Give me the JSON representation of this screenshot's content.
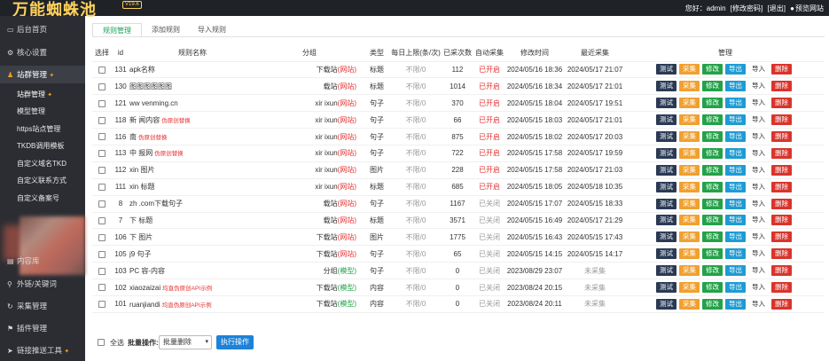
{
  "header": {
    "logo": "万能蜘蛛池",
    "version": "V19.6",
    "greeting": "您好：admin",
    "change_password": "[修改密码]",
    "logout": "[退出]",
    "preview_site": "预览网站"
  },
  "sidebar": {
    "items": [
      {
        "icon": "monitor-icon",
        "label": "后台首页"
      },
      {
        "icon": "gear-icon",
        "label": "核心设置"
      },
      {
        "icon": "user-icon",
        "label": "站群管理"
      }
    ],
    "subitems": [
      "站群管理",
      "模型管理",
      "https站点管理",
      "TKDB调用模板",
      "自定义域名TKD",
      "自定义联系方式",
      "自定义备案号"
    ],
    "bottom_items": [
      {
        "icon": "database-icon",
        "label": "内容库"
      },
      {
        "icon": "link-icon",
        "label": "外链/关键词"
      },
      {
        "icon": "collect-icon",
        "label": "采集管理"
      },
      {
        "icon": "plugin-icon",
        "label": "插件管理"
      },
      {
        "icon": "send-icon",
        "label": "链接推送工具"
      }
    ]
  },
  "tabs": [
    "规则管理",
    "添加规则",
    "导入规则"
  ],
  "table": {
    "headers": [
      "选择",
      "id",
      "规则名称",
      "分组",
      "类型",
      "每日上限(条/次)",
      "已采次数",
      "自动采集",
      "修改时间",
      "最近采集",
      "管理"
    ],
    "buttons": {
      "test": "测试",
      "collect": "采集",
      "edit": "修改",
      "export": "导出",
      "import": "导入",
      "delete": "删除"
    },
    "rows": [
      {
        "id": "131",
        "name": "apk名称",
        "tag": "",
        "group": "下载站",
        "group_suffix": "(网站)",
        "type": "标题",
        "limit": "不限/0",
        "count": "112",
        "auto": "已开启",
        "mtime": "2024/05/16 18:36",
        "last": "2024/05/17 21:07"
      },
      {
        "id": "130",
        "name": "图图图图图图",
        "tag": "",
        "group": "载站",
        "group_suffix": "(网站)",
        "type": "标题",
        "limit": "不限/0",
        "count": "1014",
        "auto": "已开启",
        "mtime": "2024/05/16 18:34",
        "last": "2024/05/17 21:01"
      },
      {
        "id": "121",
        "name": "ww venming.cn",
        "tag": "",
        "group": "xir ixun",
        "group_suffix": "(网站)",
        "type": "句子",
        "limit": "不限/0",
        "count": "370",
        "auto": "已开启",
        "mtime": "2024/05/15 18:04",
        "last": "2024/05/17 19:51"
      },
      {
        "id": "118",
        "name": "新 闻内容",
        "tag": "伪原创替换",
        "group": "xir ixun",
        "group_suffix": "(网站)",
        "type": "句子",
        "limit": "不限/0",
        "count": "66",
        "auto": "已开启",
        "mtime": "2024/05/15 18:03",
        "last": "2024/05/17 21:01"
      },
      {
        "id": "116",
        "name": "南",
        "tag": "伪原创替换",
        "group": "xir ixun",
        "group_suffix": "(网站)",
        "type": "句子",
        "limit": "不限/0",
        "count": "875",
        "auto": "已开启",
        "mtime": "2024/05/15 18:02",
        "last": "2024/05/17 20:03"
      },
      {
        "id": "113",
        "name": "中 报网",
        "tag": "伪原创替换",
        "group": "xir ixun",
        "group_suffix": "(网站)",
        "type": "句子",
        "limit": "不限/0",
        "count": "722",
        "auto": "已开启",
        "mtime": "2024/05/15 17:58",
        "last": "2024/05/17 19:59"
      },
      {
        "id": "112",
        "name": "xin 图片",
        "tag": "",
        "group": "xir ixun",
        "group_suffix": "(网站)",
        "type": "图片",
        "limit": "不限/0",
        "count": "228",
        "auto": "已开启",
        "mtime": "2024/05/15 17:58",
        "last": "2024/05/17 21:03"
      },
      {
        "id": "111",
        "name": "xin 标题",
        "tag": "",
        "group": "xir ixun",
        "group_suffix": "(网站)",
        "type": "标题",
        "limit": "不限/0",
        "count": "685",
        "auto": "已开启",
        "mtime": "2024/05/15 18:05",
        "last": "2024/05/18 10:35"
      },
      {
        "id": "8",
        "name": "zh .com下载句子",
        "tag": "",
        "group": "载站",
        "group_suffix": "(网站)",
        "type": "句子",
        "limit": "不限/0",
        "count": "1167",
        "auto": "已关闭",
        "mtime": "2024/05/15 17:07",
        "last": "2024/05/15 18:33"
      },
      {
        "id": "7",
        "name": "下 标题",
        "tag": "",
        "group": "载站",
        "group_suffix": "(网站)",
        "type": "标题",
        "limit": "不限/0",
        "count": "3571",
        "auto": "已关闭",
        "mtime": "2024/05/15 16:49",
        "last": "2024/05/17 21:29"
      },
      {
        "id": "106",
        "name": "下 图片",
        "tag": "",
        "group": "下载站",
        "group_suffix": "(网站)",
        "type": "图片",
        "limit": "不限/0",
        "count": "1775",
        "auto": "已关闭",
        "mtime": "2024/05/15 16:43",
        "last": "2024/05/15 17:43"
      },
      {
        "id": "105",
        "name": "j9 句子",
        "tag": "",
        "group": "下载站",
        "group_suffix": "(网站)",
        "type": "句子",
        "limit": "不限/0",
        "count": "65",
        "auto": "已关闭",
        "mtime": "2024/05/15 14:15",
        "last": "2024/05/15 14:17"
      },
      {
        "id": "103",
        "name": "PC 容-内容",
        "tag": "",
        "group": "分组",
        "group_suffix": "(模型)",
        "type": "句子",
        "limit": "不限/0",
        "count": "0",
        "auto": "已关闭",
        "mtime": "2023/08/29 23:07",
        "last": "未采集"
      },
      {
        "id": "102",
        "name": "xiaozaizai",
        "tag": "均直伪原创API示例",
        "group": "下载站",
        "group_suffix": "(模型)",
        "type": "内容",
        "limit": "不限/0",
        "count": "0",
        "auto": "已关闭",
        "mtime": "2023/08/24 20:15",
        "last": "未采集"
      },
      {
        "id": "101",
        "name": "ruanjiandi",
        "tag": "均直伪原创API示例",
        "group": "下载站",
        "group_suffix": "(模型)",
        "type": "内容",
        "limit": "不限/0",
        "count": "0",
        "auto": "已关闭",
        "mtime": "2023/08/24 20:11",
        "last": "未采集"
      }
    ]
  },
  "footer": {
    "select_all": "全选",
    "batch_label": "批量操作:",
    "batch_value": "批量删除",
    "run_button": "执行操作"
  },
  "colors": {
    "sidebar_bg": "#2b2d33",
    "topbar_bg": "#1f2328",
    "logo": "#ffd15a",
    "accent_green": "#1aa35a",
    "status_on": "#e53030"
  }
}
